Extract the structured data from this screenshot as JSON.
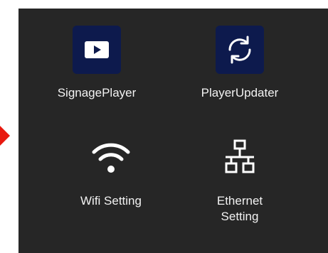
{
  "colors": {
    "panel_bg": "#262626",
    "app_icon_bg": "#0d1a4d",
    "icon_fg": "#ffffff",
    "label_color": "#f2f2f2",
    "marker_color": "#e8190f"
  },
  "apps": [
    {
      "label": "SignagePlayer",
      "icon": "play-icon"
    },
    {
      "label": "PlayerUpdater",
      "icon": "sync-icon"
    },
    {
      "label": "Wifi Setting",
      "icon": "wifi-icon"
    },
    {
      "label_line1": "Ethernet",
      "label_line2": "Setting",
      "icon": "ethernet-network-icon"
    }
  ]
}
